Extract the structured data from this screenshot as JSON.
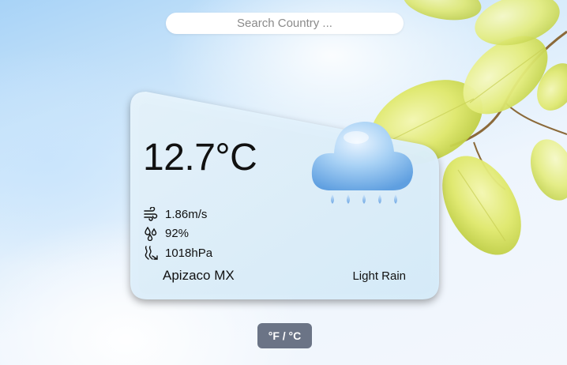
{
  "search": {
    "placeholder": "Search Country ...",
    "value": ""
  },
  "weather": {
    "temperature": "12.7°C",
    "wind": "1.86m/s",
    "humidity": "92%",
    "pressure": "1018hPa",
    "location": "Apizaco MX",
    "condition": "Light Rain",
    "condition_icon": "rain-cloud-icon"
  },
  "stat_icons": {
    "wind": "wind-icon",
    "humidity": "humidity-icon",
    "pressure": "pressure-icon"
  },
  "unit_toggle": {
    "label": "°F / °C"
  },
  "colors": {
    "card_bg": "#e7f3fc",
    "toggle_bg": "#6b7486",
    "toggle_text": "#ffffff",
    "text": "#111111"
  }
}
